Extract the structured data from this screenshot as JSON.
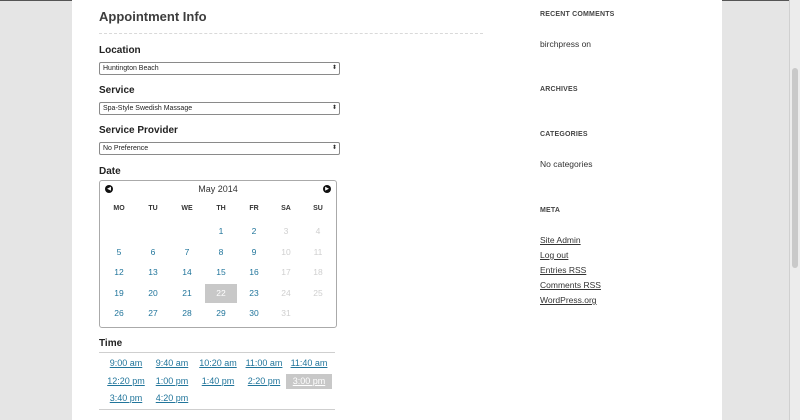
{
  "form": {
    "title": "Appointment Info",
    "location": {
      "label": "Location",
      "value": "Huntington Beach"
    },
    "service": {
      "label": "Service",
      "value": "Spa-Style Swedish Massage"
    },
    "provider": {
      "label": "Service Provider",
      "value": "No Preference"
    },
    "date": {
      "label": "Date"
    },
    "time": {
      "label": "Time"
    }
  },
  "calendar": {
    "month": "May 2014",
    "weekdays": [
      "MO",
      "TU",
      "WE",
      "TH",
      "FR",
      "SA",
      "SU"
    ],
    "weeks": [
      [
        null,
        null,
        null,
        "1",
        "2",
        "3",
        "4"
      ],
      [
        "5",
        "6",
        "7",
        "8",
        "9",
        "10",
        "11"
      ],
      [
        "12",
        "13",
        "14",
        "15",
        "16",
        "17",
        "18"
      ],
      [
        "19",
        "20",
        "21",
        "22",
        "23",
        "24",
        "25"
      ],
      [
        "26",
        "27",
        "28",
        "29",
        "30",
        "31",
        null
      ]
    ],
    "disabled_days": [
      "3",
      "4",
      "10",
      "11",
      "17",
      "18",
      "24",
      "25",
      "31"
    ],
    "selected_day": "22"
  },
  "time_slots": {
    "rows": [
      [
        "9:00 am",
        "9:40 am",
        "10:20 am",
        "11:00 am",
        "11:40 am"
      ],
      [
        "12:20 pm",
        "1:00 pm",
        "1:40 pm",
        "2:20 pm",
        "3:00 pm"
      ],
      [
        "3:40 pm",
        "4:20 pm"
      ]
    ],
    "selected": "3:00 pm"
  },
  "sidebar": {
    "recent_comments": {
      "title": "RECENT COMMENTS",
      "items": [
        "birchpress on"
      ]
    },
    "archives": {
      "title": "ARCHIVES"
    },
    "categories": {
      "title": "CATEGORIES",
      "empty_text": "No categories"
    },
    "meta": {
      "title": "META",
      "links": [
        "Site Admin",
        "Log out",
        "Entries RSS",
        "Comments RSS",
        "WordPress.org"
      ]
    }
  },
  "colors": {
    "link": "#21759b",
    "selected_bg": "#c8c8c8",
    "disabled": "#cfcfcf"
  },
  "icons": {
    "prev": "chevron-left-icon",
    "next": "chevron-right-icon",
    "select_arrow": "up-down-arrows-icon"
  }
}
